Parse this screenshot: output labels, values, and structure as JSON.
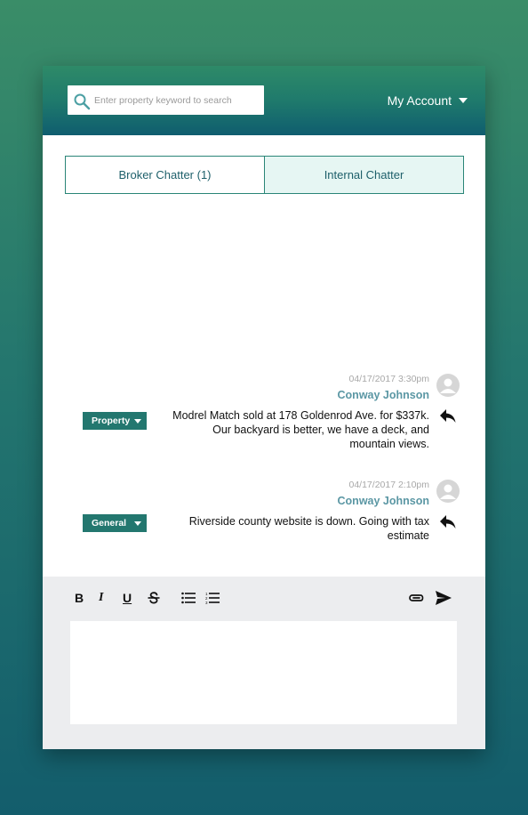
{
  "header": {
    "search_placeholder": "Enter property keyword to search",
    "account_label": "My Account"
  },
  "tabs": [
    {
      "label": "Broker Chatter (1)",
      "active": false
    },
    {
      "label": "Internal Chatter",
      "active": true
    }
  ],
  "messages": [
    {
      "timestamp": "04/17/2017 3:30pm",
      "author": "Conway Johnson",
      "category": "Property",
      "text": "Modrel Match sold at 178 Goldenrod Ave. for $337k. Our backyard is better, we have a deck, and mountain views."
    },
    {
      "timestamp": "04/17/2017 2:10pm",
      "author": "Conway Johnson",
      "category": "General",
      "text": "Riverside county website is down. Going with tax estimate"
    }
  ],
  "composer": {
    "toolbar": {
      "bold": "B",
      "italic": "I",
      "underline": "U"
    },
    "editor_value": ""
  },
  "colors": {
    "accent": "#23776f",
    "header_top": "#2e8a68",
    "header_bottom": "#0f5d6f",
    "author": "#5b97a4",
    "tab_active_bg": "#e6f6f3"
  },
  "icons": [
    "search-icon",
    "chevron-down-icon",
    "avatar-icon",
    "reply-icon",
    "bold-icon",
    "italic-icon",
    "underline-icon",
    "strikethrough-icon",
    "bullet-list-icon",
    "numbered-list-icon",
    "attach-icon",
    "send-icon"
  ]
}
